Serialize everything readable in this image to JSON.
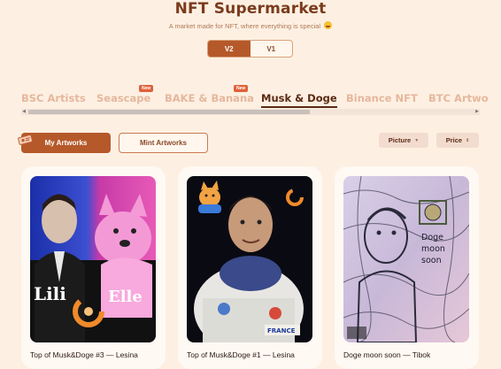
{
  "header": {
    "title": "NFT Supermarket",
    "subtitle": "A market made for NFT, where everything is special",
    "emoji": "smiling-face-emoji"
  },
  "version_toggle": {
    "v2": "V2",
    "v1": "V1",
    "selected": "V2"
  },
  "tabs": [
    {
      "label": "BSC Artists",
      "badge": ""
    },
    {
      "label": "Seascape",
      "badge": "New"
    },
    {
      "label": "BAKE & Banana",
      "badge": "New"
    },
    {
      "label": "Musk & Doge",
      "badge": "",
      "active": true
    },
    {
      "label": "Binance NFT",
      "badge": ""
    },
    {
      "label": "BTC Artwo",
      "badge": ""
    }
  ],
  "toolbar": {
    "my_artworks": "My Artworks",
    "mint_artworks": "Mint Artworks",
    "picture_select": "Picture",
    "price_select": "Price"
  },
  "cards": [
    {
      "caption": "Top of Musk&Doge #3 — Lesina",
      "art_text_left": "Lili",
      "art_text_right": "Elle"
    },
    {
      "caption": "Top of Musk&Doge #1 — Lesina",
      "art_text_right": "FRANCE"
    },
    {
      "caption": "Doge moon soon — Tibok",
      "art_text_right": "Doge moon soon"
    }
  ],
  "colors": {
    "background": "#fdf0e2",
    "accent": "#b6592a",
    "title": "#7a3b1c",
    "badge": "#e0603a"
  }
}
